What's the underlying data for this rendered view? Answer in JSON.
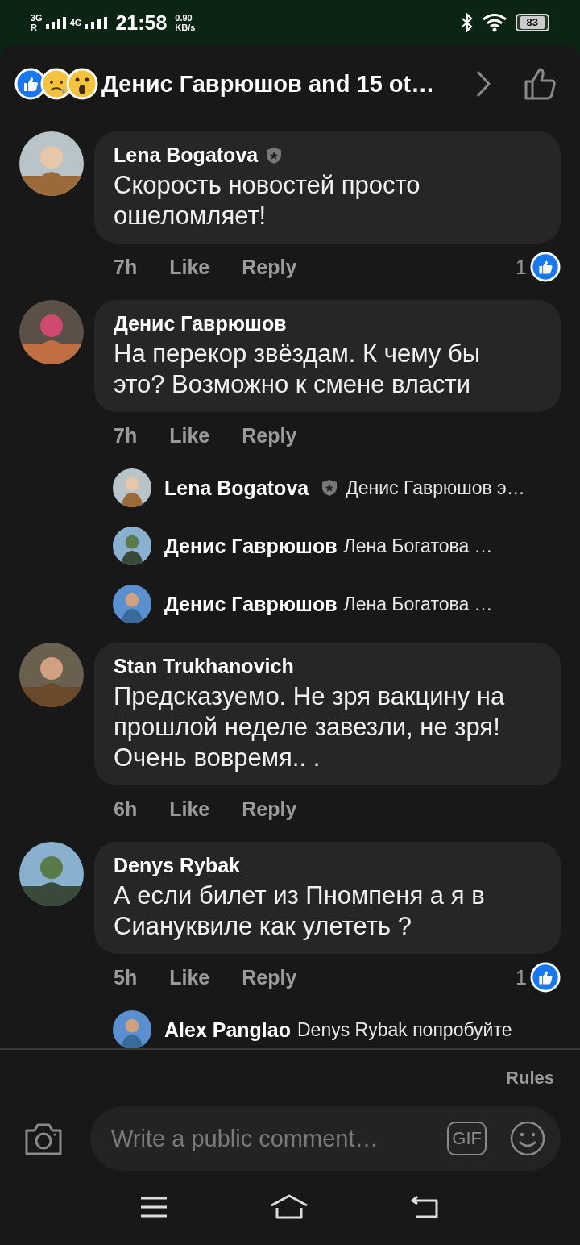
{
  "status_bar": {
    "network_1": "3G",
    "roaming": "R",
    "network_2": "4G",
    "time": "21:58",
    "speed": "0.90",
    "speed_unit": "KB/s",
    "battery": "83"
  },
  "header": {
    "title": "Денис Гаврюшов and 15 ot…"
  },
  "comments": [
    {
      "author": "Lena Bogatova",
      "badge": true,
      "text": "Скорость новостей просто ошеломляет!",
      "time": "7h",
      "like": "Like",
      "reply": "Reply",
      "reactions": "1"
    },
    {
      "author": "Денис Гаврюшов",
      "badge": false,
      "text": "На перекор звёздам. К чему бы это? Возможно к смене власти",
      "time": "7h",
      "like": "Like",
      "reply": "Reply",
      "replies": [
        {
          "author": "Lena Bogatova",
          "badge": true,
          "text": "Денис Гаврюшов э…"
        },
        {
          "author": "Денис Гаврюшов",
          "badge": false,
          "text": "Лена Богатова …"
        },
        {
          "author": "Денис Гаврюшов",
          "badge": false,
          "text": "Лена Богатова …"
        }
      ]
    },
    {
      "author": "Stan Trukhanovich",
      "badge": false,
      "text": "Предсказуемо. Не зря вакцину на прошлой неделе завезли, не зря! Очень вовремя.. .",
      "time": "6h",
      "like": "Like",
      "reply": "Reply"
    },
    {
      "author": "Denys Rybak",
      "badge": false,
      "text": "А если билет из Пномпеня а я в Сиануквиле как улететь ?",
      "time": "5h",
      "like": "Like",
      "reply": "Reply",
      "reactions": "1",
      "replies": [
        {
          "author": "Alex Panglao",
          "badge": false,
          "text": "Denys Rybak попробуйте"
        }
      ]
    }
  ],
  "composer": {
    "rules": "Rules",
    "placeholder": "Write a public comment…",
    "gif": "GIF"
  }
}
